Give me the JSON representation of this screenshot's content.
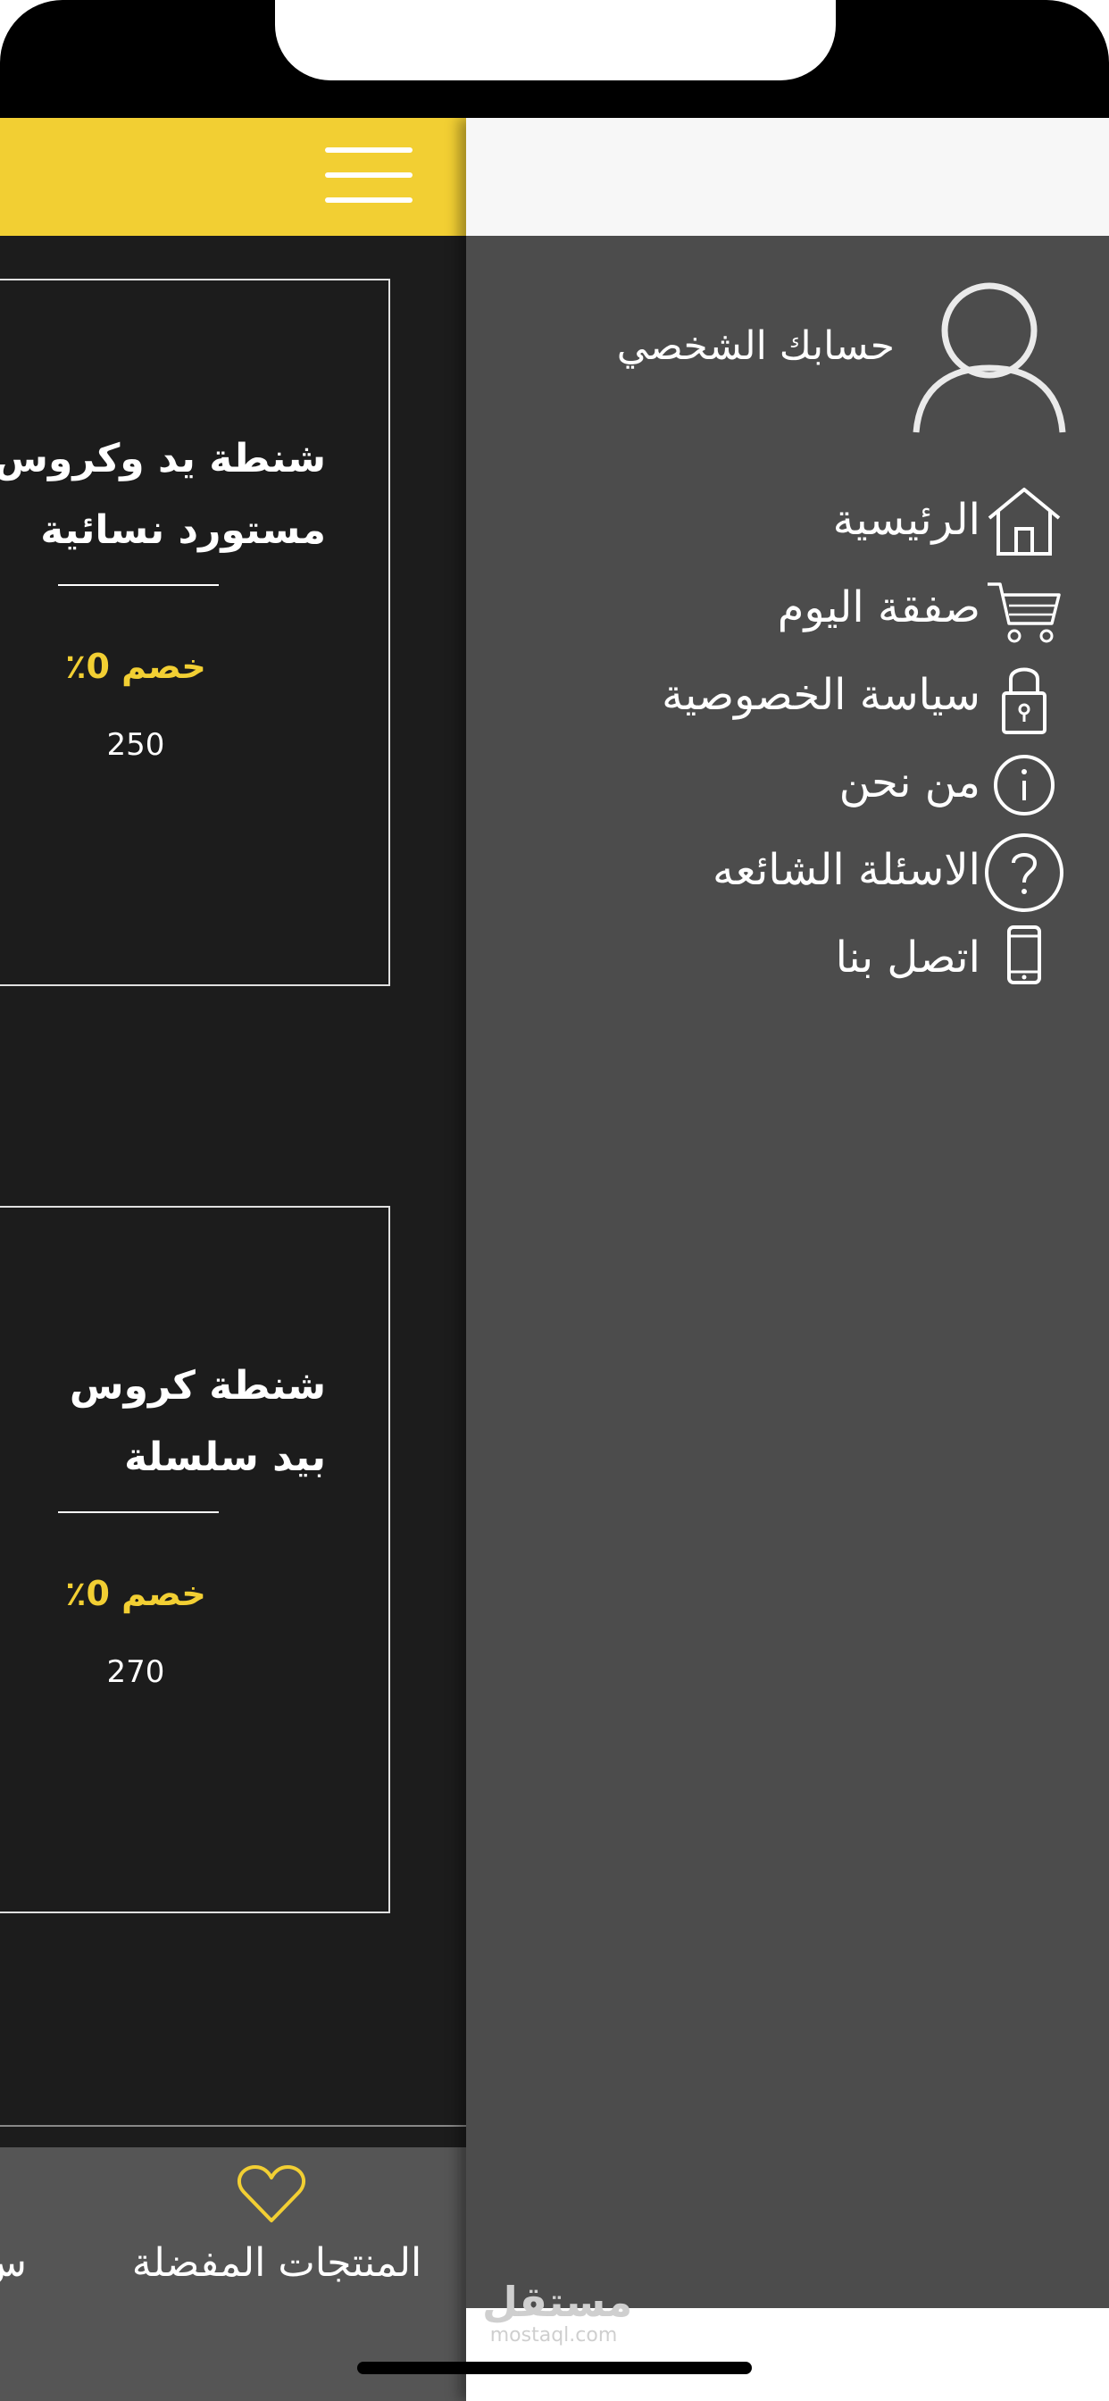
{
  "header": {
    "menu_icon": "hamburger-icon",
    "accent_color": "#f2cf33"
  },
  "products": [
    {
      "title_line1": "شنطة يد وكروس م",
      "title_line2": "مستورد نسائية",
      "discount": "خصم 0٪",
      "price": "250"
    },
    {
      "title_line1": "شنطة كروس",
      "title_line2": "بيد سلسلة",
      "discount": "خصم 0٪",
      "price": "270"
    }
  ],
  "bottom_nav": {
    "favorites_label": "المنتجات المفضلة",
    "favorites_icon": "heart-icon",
    "partial_label": "س"
  },
  "drawer": {
    "profile_label": "حسابك الشخصي",
    "profile_icon": "user-icon",
    "items": [
      {
        "label": "الرئيسية",
        "icon": "home-icon"
      },
      {
        "label": "صفقة اليوم",
        "icon": "cart-icon"
      },
      {
        "label": "سياسة الخصوصية",
        "icon": "lock-icon"
      },
      {
        "label": "من نحن",
        "icon": "info-icon"
      },
      {
        "label": "الاسئلة الشائعه",
        "icon": "question-icon"
      },
      {
        "label": "اتصل بنا",
        "icon": "phone-icon"
      }
    ]
  },
  "watermark": {
    "line1": "مستقل",
    "line2": "mostaql.com"
  }
}
